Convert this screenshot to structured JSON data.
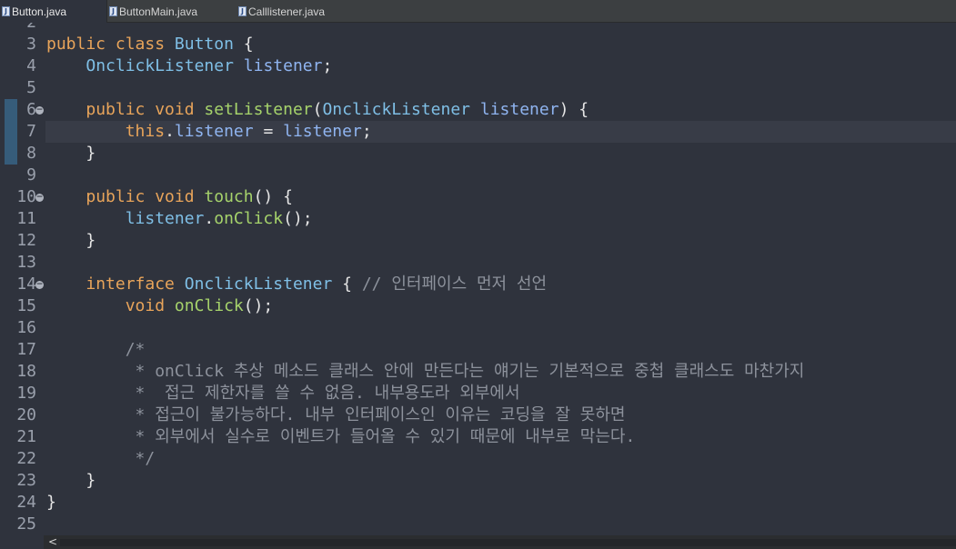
{
  "tabs": [
    {
      "label": "Button.java",
      "active": true,
      "icon": "java-file-icon"
    },
    {
      "label": "ButtonMain.java",
      "active": false,
      "icon": "java-file-icon"
    },
    {
      "label": "Calllistener.java",
      "active": false,
      "icon": "java-file-icon"
    }
  ],
  "editor": {
    "first_partial_line_number": "2",
    "current_line": "7",
    "lines": [
      {
        "n": "3",
        "fold": false,
        "tokens": [
          [
            "kw",
            "public class "
          ],
          [
            "ty",
            "Button"
          ],
          [
            "pl",
            " {"
          ]
        ]
      },
      {
        "n": "4",
        "fold": false,
        "tokens": [
          [
            "pl",
            "    "
          ],
          [
            "ty",
            "OnclickListener"
          ],
          [
            "pl",
            " "
          ],
          [
            "fld",
            "listener"
          ],
          [
            "pl",
            ";"
          ]
        ]
      },
      {
        "n": "5",
        "fold": false,
        "tokens": []
      },
      {
        "n": "6",
        "fold": true,
        "tokens": [
          [
            "pl",
            "    "
          ],
          [
            "kw",
            "public void "
          ],
          [
            "fn",
            "setListener"
          ],
          [
            "pl",
            "("
          ],
          [
            "ty",
            "OnclickListener"
          ],
          [
            "pl",
            " "
          ],
          [
            "fld",
            "listener"
          ],
          [
            "pl",
            ") {"
          ]
        ]
      },
      {
        "n": "7",
        "fold": false,
        "tokens": [
          [
            "pl",
            "        "
          ],
          [
            "kw",
            "this"
          ],
          [
            "pl",
            "."
          ],
          [
            "fld",
            "listener"
          ],
          [
            "pl",
            " = "
          ],
          [
            "fld",
            "listener"
          ],
          [
            "pl",
            ";"
          ]
        ]
      },
      {
        "n": "8",
        "fold": false,
        "tokens": [
          [
            "pl",
            "    }"
          ]
        ]
      },
      {
        "n": "9",
        "fold": false,
        "tokens": []
      },
      {
        "n": "10",
        "fold": true,
        "tokens": [
          [
            "pl",
            "    "
          ],
          [
            "kw",
            "public void "
          ],
          [
            "fn",
            "touch"
          ],
          [
            "pl",
            "() {"
          ]
        ]
      },
      {
        "n": "11",
        "fold": false,
        "tokens": [
          [
            "pl",
            "        "
          ],
          [
            "ty",
            "listener"
          ],
          [
            "pl",
            "."
          ],
          [
            "fn",
            "onClick"
          ],
          [
            "pl",
            "();"
          ]
        ]
      },
      {
        "n": "12",
        "fold": false,
        "tokens": [
          [
            "pl",
            "    }"
          ]
        ]
      },
      {
        "n": "13",
        "fold": false,
        "tokens": []
      },
      {
        "n": "14",
        "fold": true,
        "tokens": [
          [
            "pl",
            "    "
          ],
          [
            "kw",
            "interface "
          ],
          [
            "ty",
            "OnclickListener"
          ],
          [
            "pl",
            " { "
          ],
          [
            "cm",
            "// 인터페이스 먼저 선언"
          ]
        ]
      },
      {
        "n": "15",
        "fold": false,
        "tokens": [
          [
            "pl",
            "        "
          ],
          [
            "kw",
            "void "
          ],
          [
            "fn",
            "onClick"
          ],
          [
            "pl",
            "();"
          ]
        ]
      },
      {
        "n": "16",
        "fold": false,
        "tokens": []
      },
      {
        "n": "17",
        "fold": false,
        "tokens": [
          [
            "pl",
            "        "
          ],
          [
            "cm",
            "/*"
          ]
        ]
      },
      {
        "n": "18",
        "fold": false,
        "tokens": [
          [
            "pl",
            "         "
          ],
          [
            "cm",
            "* onClick 추상 메소드 클래스 안에 만든다는 얘기는 기본적으로 중첩 클래스도 마찬가지"
          ]
        ]
      },
      {
        "n": "19",
        "fold": false,
        "tokens": [
          [
            "pl",
            "         "
          ],
          [
            "cm",
            "*  접근 제한자를 쓸 수 없음. 내부용도라 외부에서"
          ]
        ]
      },
      {
        "n": "20",
        "fold": false,
        "tokens": [
          [
            "pl",
            "         "
          ],
          [
            "cm",
            "* 접근이 불가능하다. 내부 인터페이스인 이유는 코딩을 잘 못하면"
          ]
        ]
      },
      {
        "n": "21",
        "fold": false,
        "tokens": [
          [
            "pl",
            "         "
          ],
          [
            "cm",
            "* 외부에서 실수로 이벤트가 들어올 수 있기 때문에 내부로 막는다."
          ]
        ]
      },
      {
        "n": "22",
        "fold": false,
        "tokens": [
          [
            "pl",
            "         "
          ],
          [
            "cm",
            "*/"
          ]
        ]
      },
      {
        "n": "23",
        "fold": false,
        "tokens": [
          [
            "pl",
            "    }"
          ]
        ]
      },
      {
        "n": "24",
        "fold": false,
        "tokens": [
          [
            "pl",
            "}"
          ]
        ]
      },
      {
        "n": "25",
        "fold": false,
        "tokens": []
      }
    ]
  },
  "scrollbar": {
    "left_arrow": "<"
  },
  "colors": {
    "background": "#2f333d",
    "keyword": "#e8a45a",
    "type": "#7fbfe6",
    "method": "#a6d36b",
    "field": "#8fb4f0",
    "comment": "#8d929c",
    "current_line": "#383c47"
  }
}
